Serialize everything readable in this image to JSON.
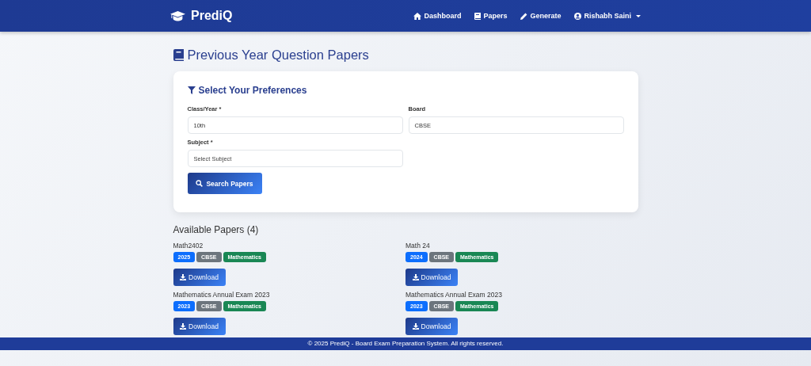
{
  "navbar": {
    "brand": "PrediQ",
    "links": [
      {
        "label": "Dashboard"
      },
      {
        "label": "Papers"
      },
      {
        "label": "Generate"
      },
      {
        "label": "Rishabh Saini",
        "dropdown": true
      }
    ]
  },
  "page_title": "Previous Year Question Papers",
  "preferences": {
    "title": "Select Your Preferences",
    "fields": [
      {
        "label": "Class/Year *",
        "value": "10th"
      },
      {
        "label": "Board",
        "value": "CBSE"
      },
      {
        "label": "Subject *",
        "placeholder": "Select Subject"
      }
    ],
    "button": "Search Papers"
  },
  "papers_heading": "Available Papers (4)",
  "papers": [
    {
      "title": "Math2402",
      "tags": [
        {
          "text": "2025",
          "color": "#0d6efd"
        },
        {
          "text": "CBSE",
          "color": "#6c757d"
        },
        {
          "text": "Mathematics",
          "color": "#198754"
        }
      ],
      "button": "Download"
    },
    {
      "title": "Math 24",
      "tags": [
        {
          "text": "2024",
          "color": "#0d6efd"
        },
        {
          "text": "CBSE",
          "color": "#6c757d"
        },
        {
          "text": "Mathematics",
          "color": "#198754"
        }
      ],
      "button": "Download"
    },
    {
      "title": "Mathematics Annual Exam 2023",
      "tags": [
        {
          "text": "2023",
          "color": "#0d6efd"
        },
        {
          "text": "CBSE",
          "color": "#6c757d"
        },
        {
          "text": "Mathematics",
          "color": "#198754"
        }
      ],
      "button": "Download"
    },
    {
      "title": "Mathematics Annual Exam 2023",
      "tags": [
        {
          "text": "2023",
          "color": "#0d6efd"
        },
        {
          "text": "CBSE",
          "color": "#6c757d"
        },
        {
          "text": "Mathematics",
          "color": "#198754"
        }
      ],
      "button": "Download"
    }
  ],
  "footer": "© 2025 PrediQ - Board Exam Preparation System. All rights reserved."
}
